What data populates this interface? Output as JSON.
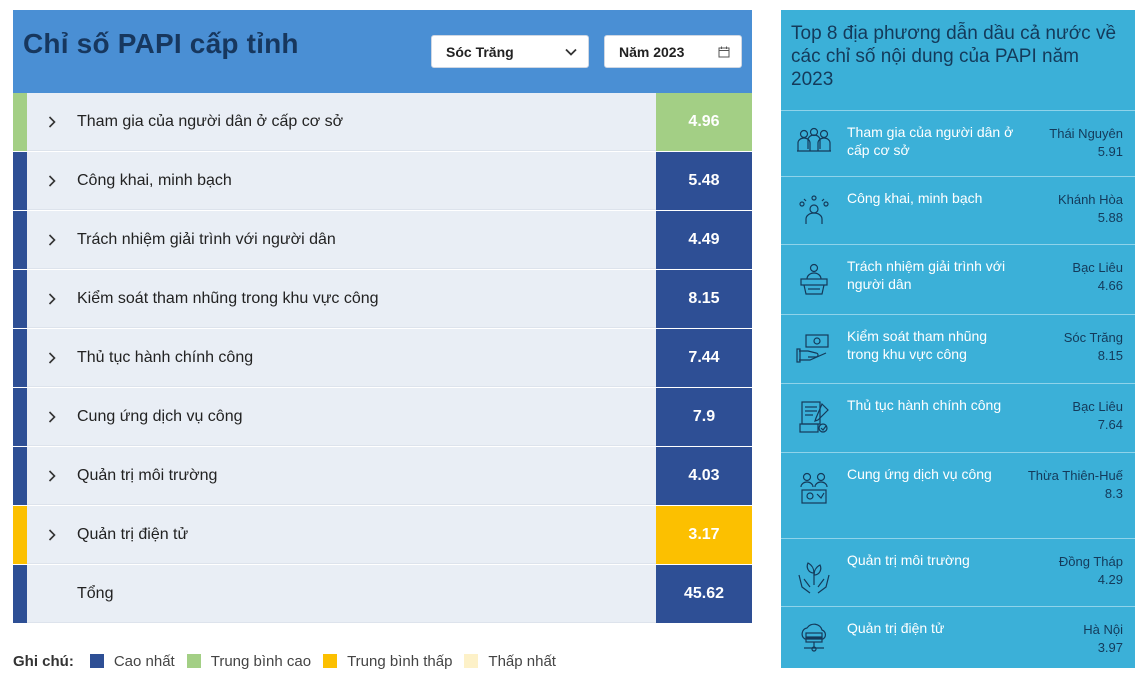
{
  "header": {
    "title": "Chỉ số PAPI cấp tỉnh",
    "province": "Sóc Trăng",
    "year": "Năm 2023"
  },
  "colors": {
    "highest": "#2e4f95",
    "upper_average": "#a3cf85",
    "lower_average": "#fcc000",
    "lowest": "#fdf1c8"
  },
  "indicators": [
    {
      "label": "Tham gia của người dân ở cấp cơ sở",
      "score": "4.96",
      "level": "upper_average"
    },
    {
      "label": "Công khai, minh bạch",
      "score": "5.48",
      "level": "highest"
    },
    {
      "label": "Trách nhiệm giải trình với người dân",
      "score": "4.49",
      "level": "highest"
    },
    {
      "label": "Kiểm soát tham nhũng trong khu vực công",
      "score": "8.15",
      "level": "highest"
    },
    {
      "label": "Thủ tục hành chính công",
      "score": "7.44",
      "level": "highest"
    },
    {
      "label": "Cung ứng dịch vụ công",
      "score": "7.9",
      "level": "highest"
    },
    {
      "label": "Quản trị môi trường",
      "score": "4.03",
      "level": "highest"
    },
    {
      "label": "Quản trị điện tử",
      "score": "3.17",
      "level": "lower_average"
    }
  ],
  "total": {
    "label": "Tổng",
    "score": "45.62",
    "level": "highest"
  },
  "legend": {
    "label": "Ghi chú:",
    "items": [
      {
        "name": "Cao nhất",
        "level": "highest"
      },
      {
        "name": "Trung bình cao",
        "level": "upper_average"
      },
      {
        "name": "Trung bình thấp",
        "level": "lower_average"
      },
      {
        "name": "Thấp nhất",
        "level": "lowest"
      }
    ]
  },
  "top8": {
    "title": "Top 8 địa phương dẫn dầu cả nước về các chỉ số nội dung của PAPI năm 2023",
    "items": [
      {
        "name": "Tham gia của người dân ở cấp cơ sở",
        "province": "Thái Nguyên",
        "score": "5.91",
        "icon": "people-group-icon"
      },
      {
        "name": "Công khai, minh bạch",
        "province": "Khánh Hòa",
        "score": "5.88",
        "icon": "speaker-idea-icon"
      },
      {
        "name": "Trách nhiệm giải trình với người dân",
        "province": "Bạc Liêu",
        "score": "4.66",
        "icon": "podium-speaker-icon"
      },
      {
        "name": "Kiểm soát tham nhũng trong khu vực công",
        "province": "Sóc Trăng",
        "score": "8.15",
        "icon": "hand-money-icon"
      },
      {
        "name": "Thủ tục hành chính công",
        "province": "Bạc Liêu",
        "score": "7.64",
        "icon": "document-check-icon"
      },
      {
        "name": "Cung ứng dịch vụ công",
        "province": "Thừa Thiên-Huế",
        "score": "8.3",
        "icon": "service-people-icon"
      },
      {
        "name": "Quản trị môi trường",
        "province": "Đồng Tháp",
        "score": "4.29",
        "icon": "hands-plant-icon"
      },
      {
        "name": "Quản trị điện tử",
        "province": "Hà Nội",
        "score": "3.97",
        "icon": "cloud-server-icon"
      }
    ]
  }
}
